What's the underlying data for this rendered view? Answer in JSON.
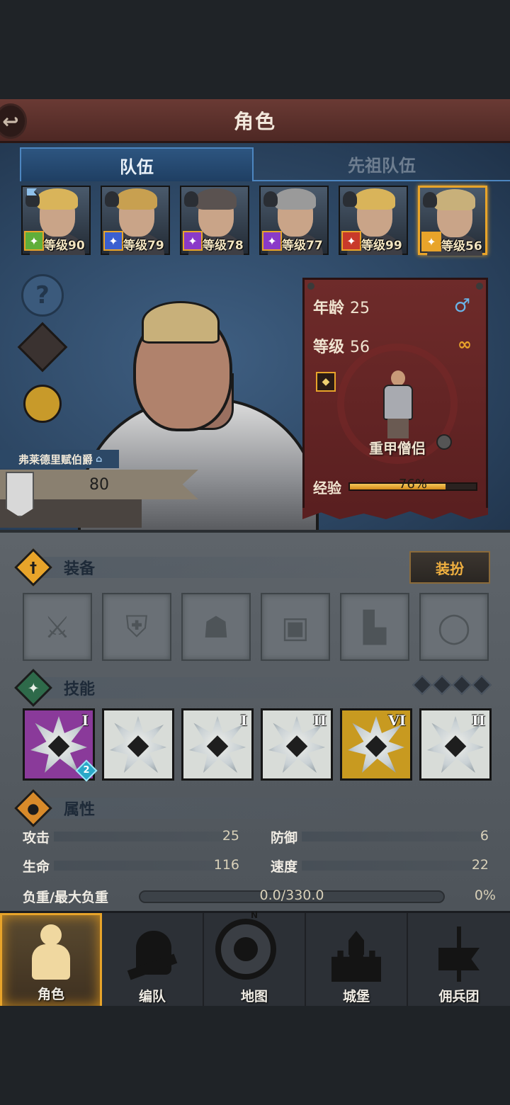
{
  "header": {
    "title": "角色",
    "back_icon": "back-arrow-icon"
  },
  "tabs": [
    {
      "label": "队伍",
      "active": true
    },
    {
      "label": "先祖队伍",
      "active": false
    }
  ],
  "party": [
    {
      "level_text": "等级90",
      "class_icon": "sword-icon",
      "badge_color": "#5fae3a",
      "hair_color": "#d9b45a",
      "has_flag": true
    },
    {
      "level_text": "等级79",
      "class_icon": "dagger-icon",
      "badge_color": "#3a5fd0",
      "hair_color": "#c8a050",
      "has_flag": false
    },
    {
      "level_text": "等级78",
      "class_icon": "staff-icon",
      "badge_color": "#8a3ac8",
      "hair_color": "#5a5250",
      "has_flag": false
    },
    {
      "level_text": "等级77",
      "class_icon": "staff-icon",
      "badge_color": "#8a3ac8",
      "hair_color": "#9a9a9a",
      "has_flag": false
    },
    {
      "level_text": "等级99",
      "class_icon": "beast-icon",
      "badge_color": "#c83a2a",
      "hair_color": "#d9b45a",
      "has_flag": false
    },
    {
      "level_text": "等级56",
      "class_icon": "shield-icon",
      "badge_color": "#e8a42a",
      "hair_color": "#c8b07a",
      "has_flag": false,
      "selected": true
    }
  ],
  "side_buttons": [
    "help-icon",
    "character-icon",
    "potion-icon"
  ],
  "character": {
    "title": "弗莱德里赋伯爵",
    "power": "80",
    "age_label": "年龄",
    "age": "25",
    "level_label": "等级",
    "level": "56",
    "class_name": "重甲僧侣",
    "exp_label": "经验",
    "exp_percent": 76,
    "exp_text": "76%"
  },
  "equipment": {
    "title": "装备",
    "dress_button": "装扮",
    "slots": [
      "sword-slot-icon",
      "shield-slot-icon",
      "helmet-slot-icon",
      "armor-slot-icon",
      "boots-slot-icon",
      "ring-slot-icon"
    ]
  },
  "skills": {
    "title": "技能",
    "items": [
      {
        "name": "spear-attack-skill-icon",
        "rank": "I",
        "bg": "#8a3a9a",
        "tier": "2"
      },
      {
        "name": "crystal-heal-skill-icon",
        "rank": "",
        "bg": "#d8dcd8"
      },
      {
        "name": "crystal-buff-skill-icon",
        "rank": "I",
        "bg": "#d8dcd8"
      },
      {
        "name": "burst-skill-icon",
        "rank": "II",
        "bg": "#d8dcd8"
      },
      {
        "name": "shield-skill-icon",
        "rank": "VI",
        "bg": "#c89a20"
      },
      {
        "name": "shockwave-skill-icon",
        "rank": "II",
        "bg": "#d8dcd8"
      }
    ]
  },
  "attributes": {
    "title": "属性",
    "attack_label": "攻击",
    "attack": "25",
    "defense_label": "防御",
    "defense": "6",
    "hp_label": "生命",
    "hp": "116",
    "speed_label": "速度",
    "speed": "22",
    "load_label": "负重/最大负重",
    "load": "0.0/330.0",
    "load_percent": "0%",
    "load_fraction": 0
  },
  "nav": [
    {
      "label": "角色",
      "icon": "knight-icon",
      "active": true
    },
    {
      "label": "编队",
      "icon": "helmet-team-icon",
      "active": false
    },
    {
      "label": "地图",
      "icon": "compass-icon",
      "active": false,
      "compass_letter": "N"
    },
    {
      "label": "城堡",
      "icon": "castle-icon",
      "active": false
    },
    {
      "label": "佣兵团",
      "icon": "mercenary-banner-icon",
      "active": false
    }
  ]
}
